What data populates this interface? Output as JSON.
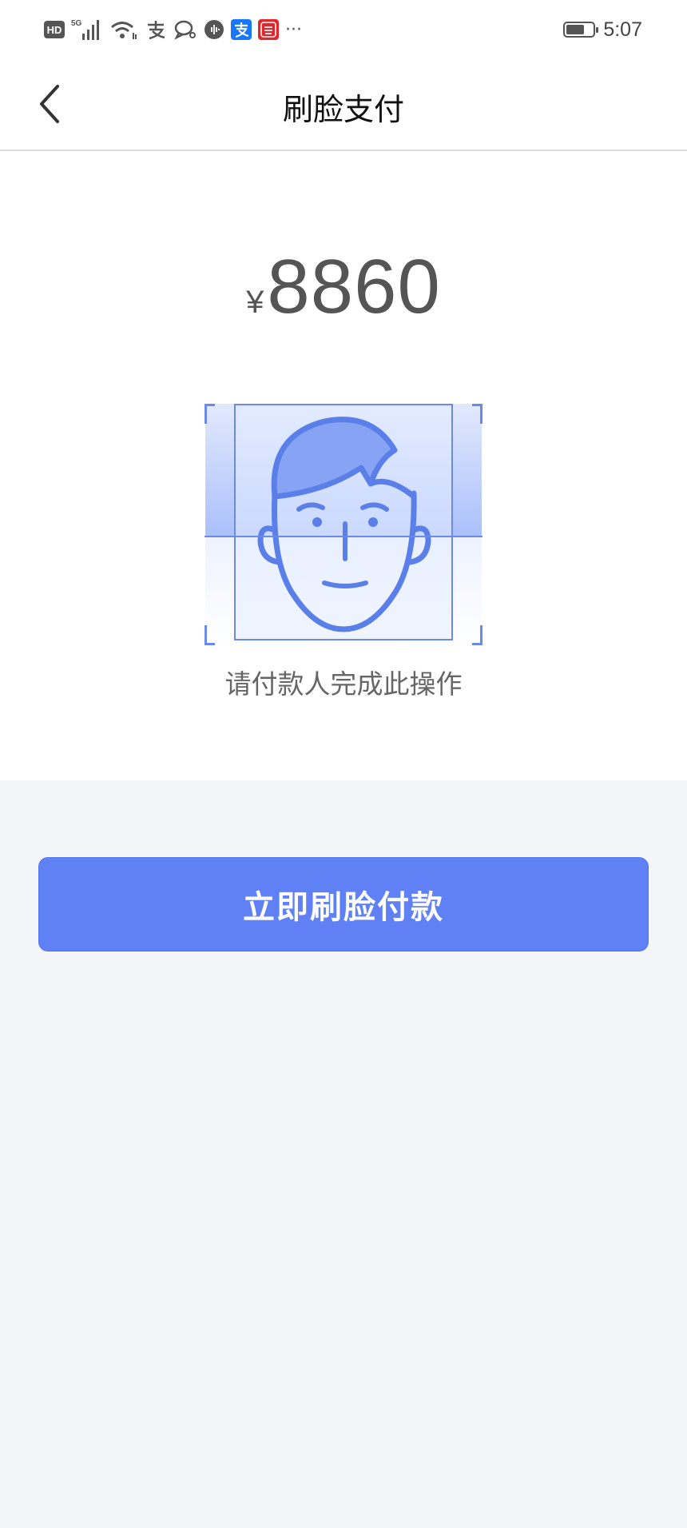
{
  "status_bar": {
    "hd_label": "HD",
    "network_label": "5G",
    "more_label": "···",
    "time": "5:07",
    "battery_level": 0.7,
    "icons": [
      "hd-icon",
      "signal-icon",
      "wifi-icon",
      "alipay-outline-icon",
      "chat-icon",
      "voice-icon",
      "alipay-app-icon",
      "taobao-app-icon",
      "more-icon"
    ]
  },
  "nav": {
    "title": "刷脸支付",
    "back_icon": "chevron-left-icon"
  },
  "payment": {
    "currency_symbol": "¥",
    "amount": "8860",
    "instruction": "请付款人完成此操作"
  },
  "actions": {
    "pay_button_label": "立即刷脸付款"
  },
  "colors": {
    "accent": "#6080f5",
    "face_line": "#5b7fe9",
    "page_bg": "#f4f5f9"
  }
}
